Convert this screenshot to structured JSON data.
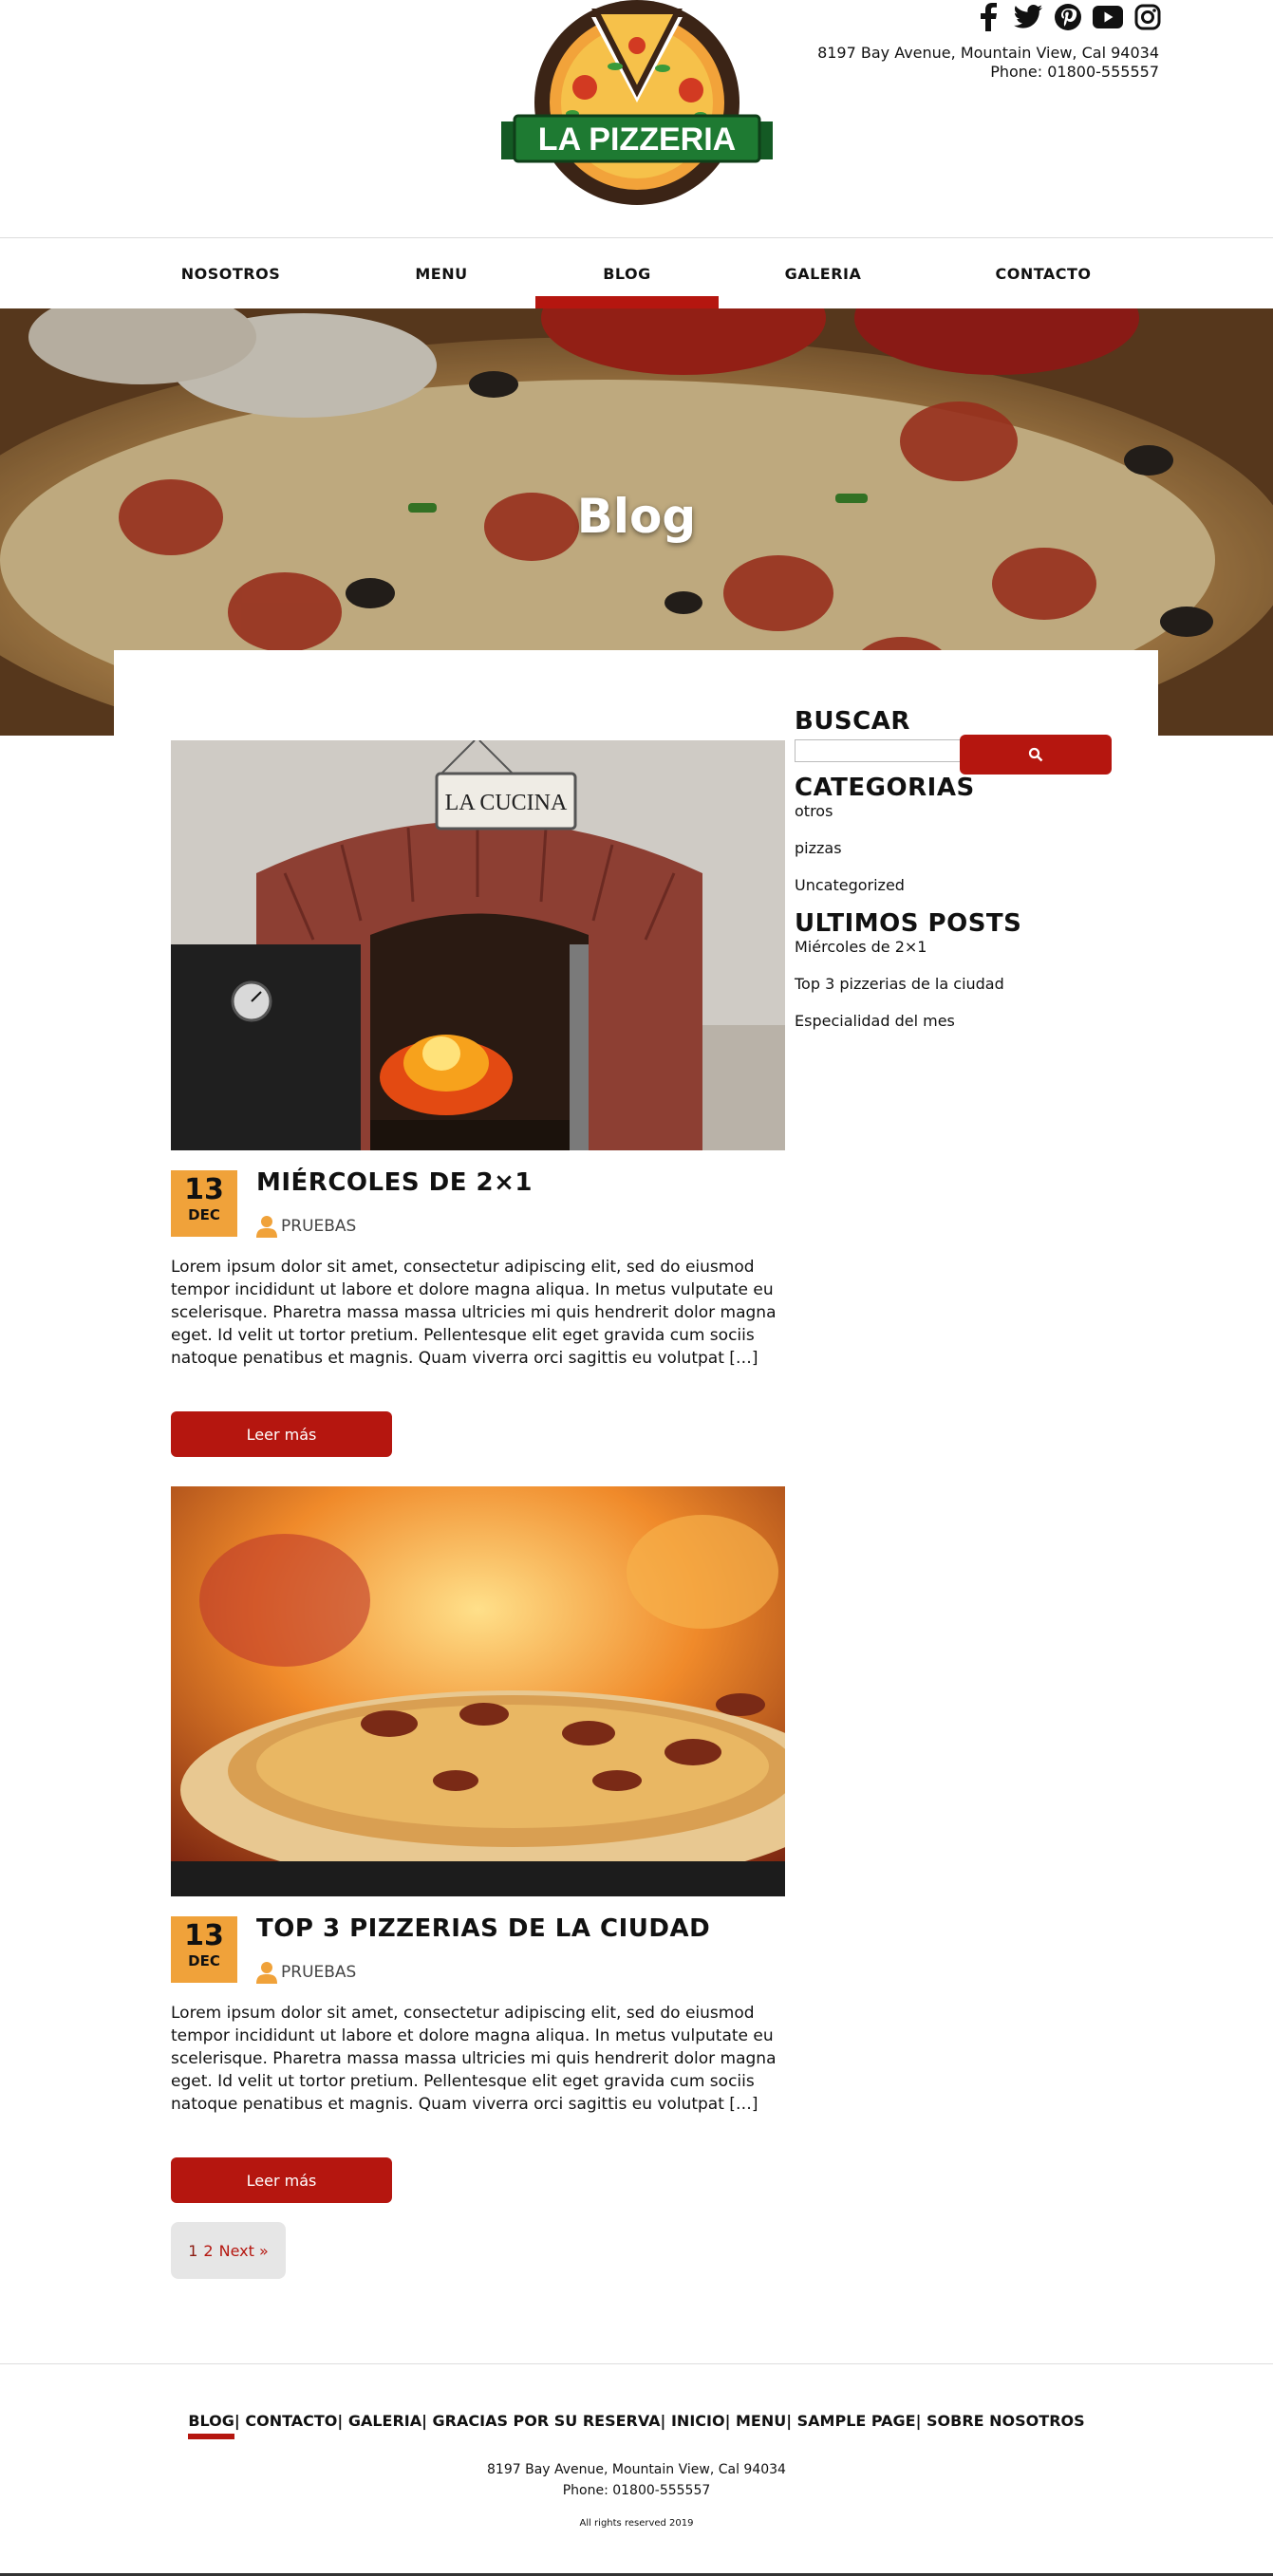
{
  "header": {
    "logo_text": "LA PIZZERIA",
    "address": "8197 Bay Avenue, Mountain View, Cal 94034",
    "phone": "Phone: 01800-555557",
    "social_icons": [
      "facebook-icon",
      "twitter-icon",
      "pinterest-icon",
      "youtube-icon",
      "instagram-icon"
    ]
  },
  "nav": {
    "items": [
      {
        "label": "NOSOTROS",
        "active": false
      },
      {
        "label": "MENU",
        "active": false
      },
      {
        "label": "BLOG",
        "active": true
      },
      {
        "label": "GALERIA",
        "active": false
      },
      {
        "label": "CONTACTO",
        "active": false
      }
    ]
  },
  "hero": {
    "title": "Blog"
  },
  "posts": [
    {
      "day": "13",
      "month": "DEC",
      "title": "MIÉRCOLES DE 2×1",
      "author": "PRUEBAS",
      "excerpt": "Lorem ipsum dolor sit amet, consectetur adipiscing elit, sed do eiusmod tempor incididunt ut labore et dolore magna aliqua. In metus vulputate eu scelerisque. Pharetra massa massa ultricies mi quis hendrerit dolor magna eget. Id velit ut tortor pretium. Pellentesque elit eget gravida cum sociis natoque penatibus et magnis. Quam viverra orci sagittis eu volutpat […]",
      "button": "Leer más",
      "sign_text": "LA CUCINA"
    },
    {
      "day": "13",
      "month": "DEC",
      "title": "TOP 3 PIZZERIAS DE LA CIUDAD",
      "author": "PRUEBAS",
      "excerpt": "Lorem ipsum dolor sit amet, consectetur adipiscing elit, sed do eiusmod tempor incididunt ut labore et dolore magna aliqua. In metus vulputate eu scelerisque. Pharetra massa massa ultricies mi quis hendrerit dolor magna eget. Id velit ut tortor pretium. Pellentesque elit eget gravida cum sociis natoque penatibus et magnis. Quam viverra orci sagittis eu volutpat […]",
      "button": "Leer más"
    }
  ],
  "pagination": {
    "current": "1",
    "next_page": "2",
    "next_label": "Next »"
  },
  "sidebar": {
    "search_title": "BUSCAR",
    "search_value": "",
    "categories_title": "CATEGORIAS",
    "categories": [
      "otros",
      "pizzas",
      "Uncategorized"
    ],
    "recent_title": "ULTIMOS POSTS",
    "recent": [
      "Miércoles de 2×1",
      "Top 3 pizzerias de la ciudad",
      "Especialidad del mes"
    ]
  },
  "footer": {
    "links": [
      "BLOG",
      "CONTACTO",
      "GALERIA",
      "GRACIAS POR SU RESERVA",
      "INICIO",
      "MENU",
      "SAMPLE PAGE",
      "SOBRE NOSOTROS"
    ],
    "active_link": "BLOG",
    "address": "8197 Bay Avenue, Mountain View, Cal 94034",
    "phone": "Phone: 01800-555557",
    "copyright": "All rights reserved 2019"
  },
  "colors": {
    "accent_red": "#b5160f",
    "date_orange": "#f0a23a",
    "logo_green": "#1e7a32"
  }
}
